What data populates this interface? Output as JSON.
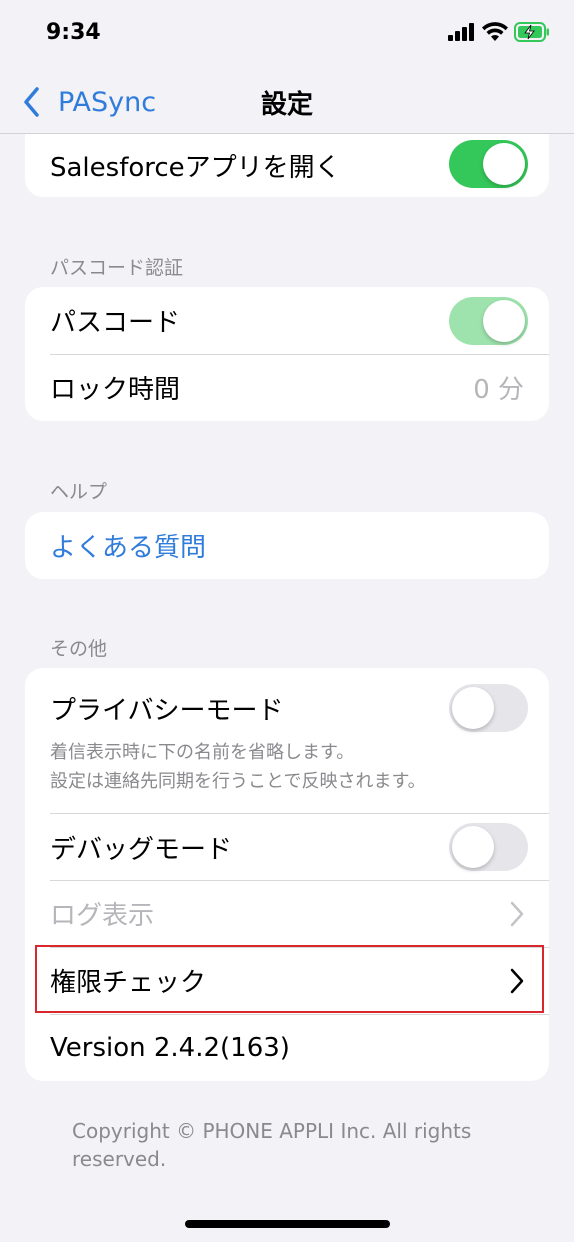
{
  "status_bar": {
    "time": "9:34",
    "battery_state": "charging"
  },
  "nav": {
    "back_label": "PASync",
    "title": "設定"
  },
  "sections": {
    "salesforce": {
      "open_app_label": "Salesforceアプリを開く",
      "open_app_on": true
    },
    "passcode": {
      "header": "パスコード認証",
      "passcode_label": "パスコード",
      "passcode_on": true,
      "lock_time_label": "ロック時間",
      "lock_time_value": "0 分"
    },
    "help": {
      "header": "ヘルプ",
      "faq_label": "よくある質問"
    },
    "other": {
      "header": "その他",
      "privacy_mode_label": "プライバシーモード",
      "privacy_mode_on": false,
      "privacy_desc_line1": "着信表示時に下の名前を省略します。",
      "privacy_desc_line2": "設定は連絡先同期を行うことで反映されます。",
      "debug_mode_label": "デバッグモード",
      "debug_mode_on": false,
      "log_view_label": "ログ表示",
      "permission_check_label": "権限チェック",
      "version_label": "Version 2.4.2(163)"
    }
  },
  "footer": {
    "copyright": "Copyright © PHONE APPLI Inc. All rights reserved."
  },
  "colors": {
    "accent": "#2f7cdb",
    "toggle_on": "#34c759",
    "highlight": "#d9272e"
  }
}
